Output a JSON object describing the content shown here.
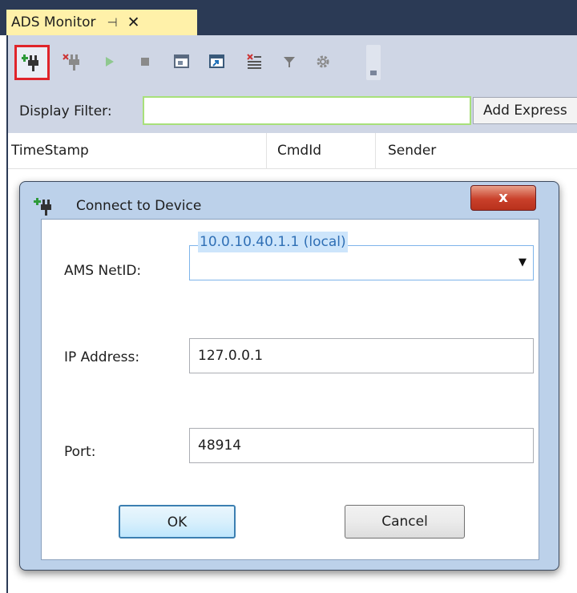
{
  "window": {
    "tab_title": "ADS Monitor",
    "pin_glyph": "⊣",
    "close_glyph": "✕"
  },
  "toolbar": {
    "icons": [
      "connect-icon",
      "disconnect-icon",
      "play-icon",
      "stop-icon",
      "window-icon",
      "window-arrow-icon",
      "clear-list-icon",
      "filter-icon",
      "settings-gear-icon"
    ]
  },
  "filter": {
    "label": "Display Filter:",
    "value": "",
    "add_expression_label": "Add Express"
  },
  "columns": [
    "TimeStamp",
    "CmdId",
    "Sender"
  ],
  "dialog": {
    "title": "Connect to Device",
    "close_label": "x",
    "ams_netid_label": "AMS NetID:",
    "ams_netid_value": "10.0.10.40.1.1 (local)",
    "ip_address_label": "IP Address:",
    "ip_address_value": "127.0.0.1",
    "port_label": "Port:",
    "port_value": "48914",
    "ok_label": "OK",
    "cancel_label": "Cancel"
  },
  "colors": {
    "title_strip": "#2b3a55",
    "active_tab": "#fff1a9",
    "toolbar_bg": "#cfd6e5",
    "highlight_border": "#e0242a"
  }
}
